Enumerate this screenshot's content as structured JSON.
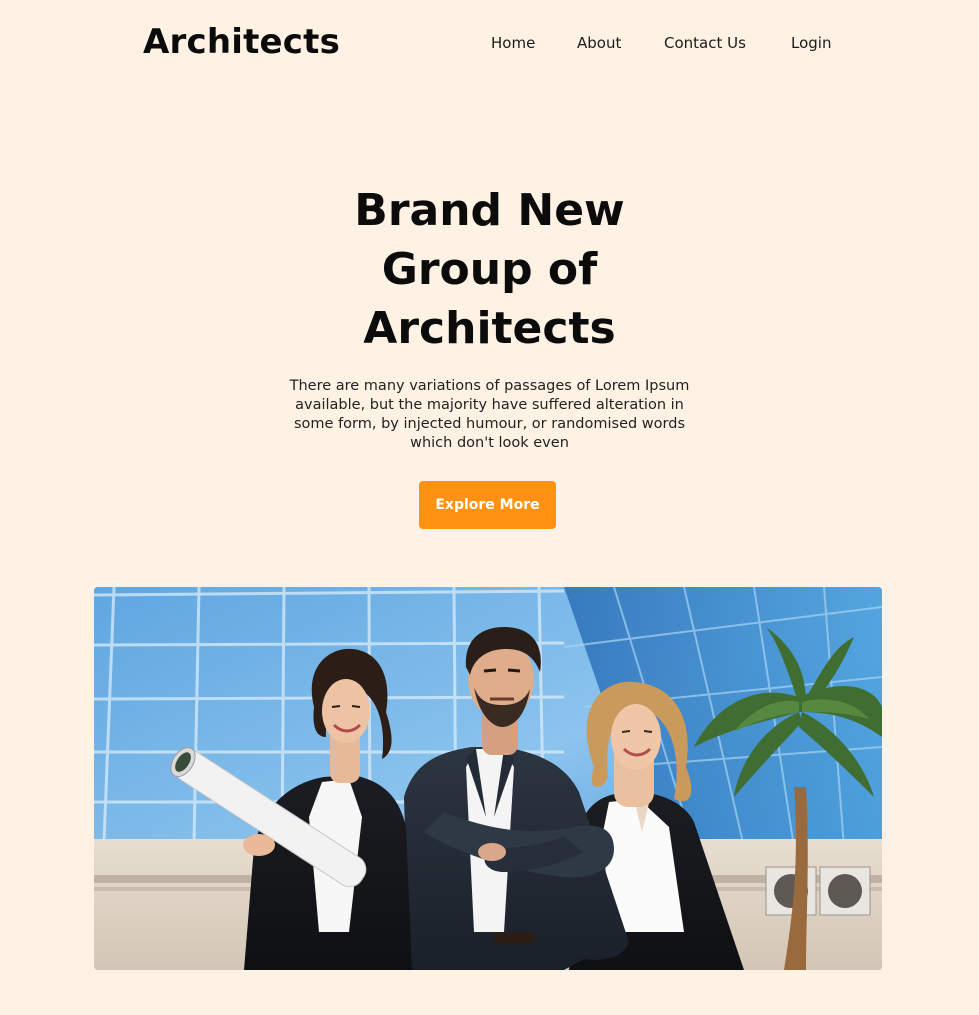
{
  "header": {
    "brand": "Architects",
    "nav": {
      "home": "Home",
      "about": "About",
      "contact": "Contact Us",
      "login": "Login"
    }
  },
  "hero": {
    "title_lines": [
      "Brand New",
      "Group of",
      "Architects"
    ],
    "description_lines": [
      "There are many variations of passages of Lorem Ipsum",
      "available, but the majority have suffered alteration in",
      "some form, by injected humour, or randomised words",
      "which don't look even"
    ],
    "cta_label": "Explore More"
  },
  "colors": {
    "background": "#fdf2e3",
    "accent": "#ff9211",
    "text": "#0b0b0b"
  }
}
